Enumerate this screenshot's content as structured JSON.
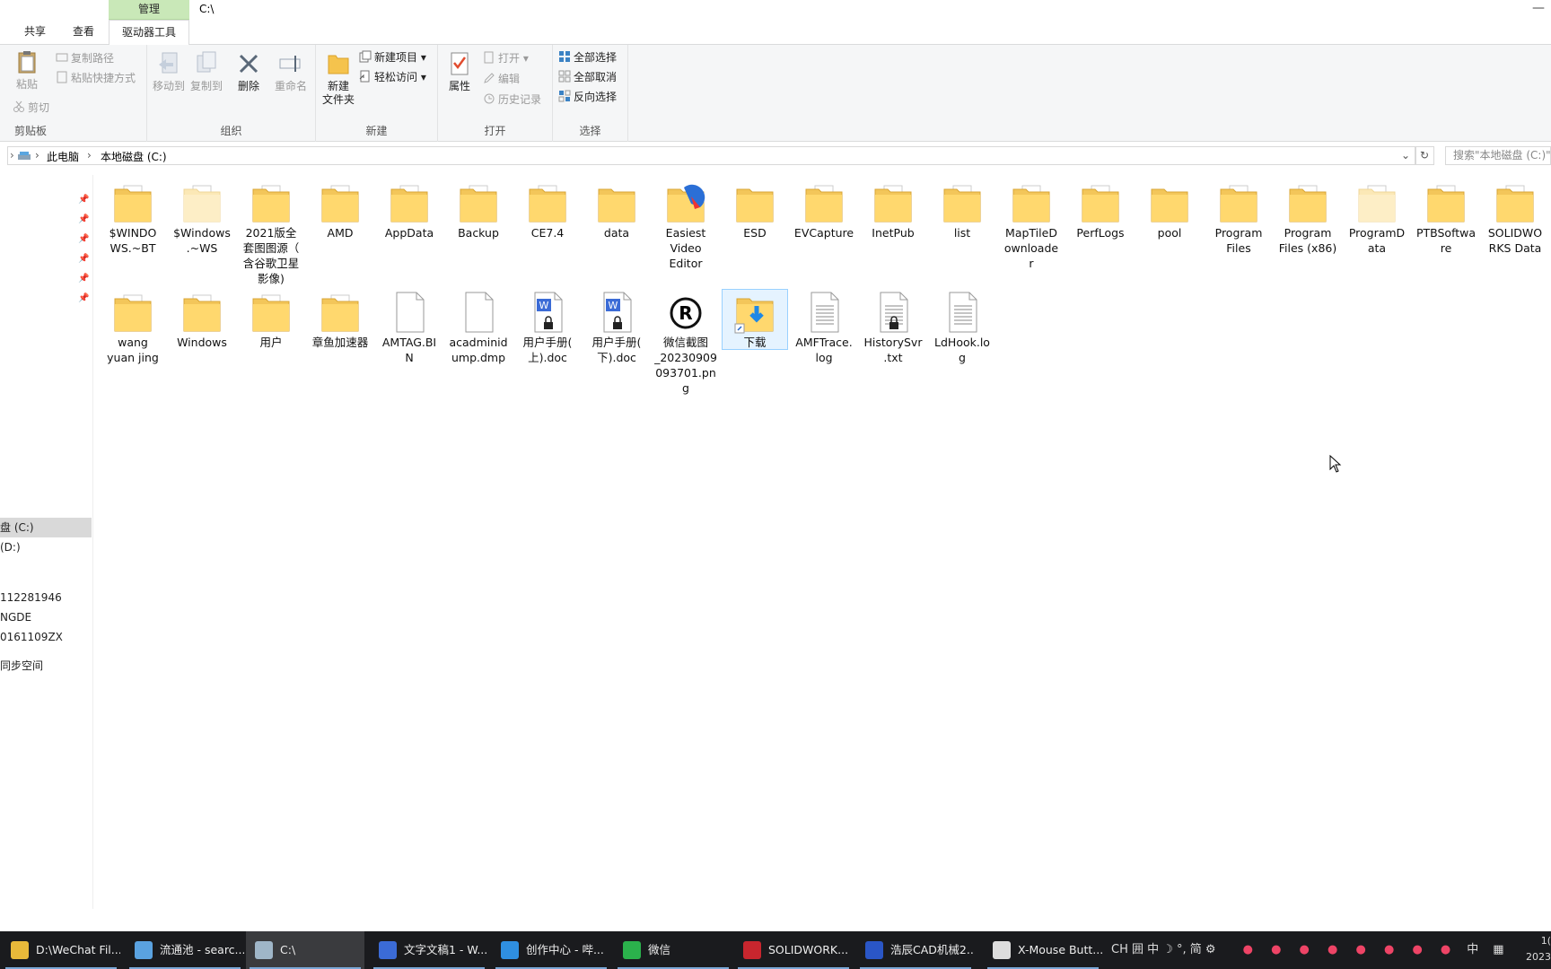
{
  "window": {
    "title": "C:\\",
    "context_group": "管理",
    "minimize": "—"
  },
  "tabs": {
    "share": "共享",
    "view": "查看",
    "drive_tools": "驱动器工具"
  },
  "ribbon": {
    "clipboard": {
      "label": "剪贴板",
      "paste": "粘贴",
      "copy_path": "复制路径",
      "paste_shortcut": "粘贴快捷方式",
      "cut": "剪切"
    },
    "organize": {
      "label": "组织",
      "move_to": "移动到",
      "copy_to": "复制到",
      "delete": "删除",
      "rename": "重命名"
    },
    "new": {
      "label": "新建",
      "new_folder_l1": "新建",
      "new_folder_l2": "文件夹",
      "new_item": "新建项目",
      "easy_access": "轻松访问"
    },
    "open": {
      "label": "打开",
      "properties": "属性",
      "open": "打开",
      "edit": "编辑",
      "history": "历史记录"
    },
    "select": {
      "label": "选择",
      "select_all": "全部选择",
      "select_none": "全部取消",
      "invert": "反向选择"
    }
  },
  "address": {
    "this_pc": "此电脑",
    "drive": "本地磁盘 (C:)",
    "search_placeholder": "搜索\"本地磁盘 (C:)\""
  },
  "nav": {
    "items": [
      "盘 (C:)",
      "(D:)",
      "112281946",
      "NGDE",
      "0161109ZX",
      "同步空间"
    ]
  },
  "files": [
    {
      "l1": "$WINDO",
      "l2": "WS.~BT",
      "l3": "",
      "l4": "",
      "kind": "folder-doc"
    },
    {
      "l1": "$Windows",
      "l2": ".~WS",
      "l3": "",
      "l4": "",
      "kind": "folder-faded"
    },
    {
      "l1": "2021版全",
      "l2": "套图图源（",
      "l3": "含谷歌卫星",
      "l4": "影像)",
      "kind": "folder-doc"
    },
    {
      "l1": "AMD",
      "l2": "",
      "l3": "",
      "l4": "",
      "kind": "folder-doc"
    },
    {
      "l1": "AppData",
      "l2": "",
      "l3": "",
      "l4": "",
      "kind": "folder-doc"
    },
    {
      "l1": "Backup",
      "l2": "",
      "l3": "",
      "l4": "",
      "kind": "folder-doc"
    },
    {
      "l1": "CE7.4",
      "l2": "",
      "l3": "",
      "l4": "",
      "kind": "folder-doc"
    },
    {
      "l1": "data",
      "l2": "",
      "l3": "",
      "l4": "",
      "kind": "folder"
    },
    {
      "l1": "Easiest",
      "l2": "Video",
      "l3": "Editor",
      "l4": "",
      "kind": "folder-app"
    },
    {
      "l1": "ESD",
      "l2": "",
      "l3": "",
      "l4": "",
      "kind": "folder"
    },
    {
      "l1": "EVCapture",
      "l2": "",
      "l3": "",
      "l4": "",
      "kind": "folder-doc"
    },
    {
      "l1": "InetPub",
      "l2": "",
      "l3": "",
      "l4": "",
      "kind": "folder-doc"
    },
    {
      "l1": "list",
      "l2": "",
      "l3": "",
      "l4": "",
      "kind": "folder-doc"
    },
    {
      "l1": "MapTileD",
      "l2": "ownloade",
      "l3": "r",
      "l4": "",
      "kind": "folder-doc"
    },
    {
      "l1": "PerfLogs",
      "l2": "",
      "l3": "",
      "l4": "",
      "kind": "folder-doc"
    },
    {
      "l1": "pool",
      "l2": "",
      "l3": "",
      "l4": "",
      "kind": "folder"
    },
    {
      "l1": "Program",
      "l2": "Files",
      "l3": "",
      "l4": "",
      "kind": "folder-doc"
    },
    {
      "l1": "Program",
      "l2": "Files (x86)",
      "l3": "",
      "l4": "",
      "kind": "folder-doc"
    },
    {
      "l1": "ProgramD",
      "l2": "ata",
      "l3": "",
      "l4": "",
      "kind": "folder-faded"
    },
    {
      "l1": "PTBSoftwa",
      "l2": "re",
      "l3": "",
      "l4": "",
      "kind": "folder-doc"
    },
    {
      "l1": "SOLIDWO",
      "l2": "RKS Data",
      "l3": "",
      "l4": "",
      "kind": "folder-doc"
    },
    {
      "l1": "wang",
      "l2": "yuan jing",
      "l3": "",
      "l4": "",
      "kind": "folder-doc"
    },
    {
      "l1": "Windows",
      "l2": "",
      "l3": "",
      "l4": "",
      "kind": "folder-doc"
    },
    {
      "l1": "用户",
      "l2": "",
      "l3": "",
      "l4": "",
      "kind": "folder-doc"
    },
    {
      "l1": "章鱼加速器",
      "l2": "",
      "l3": "",
      "l4": "",
      "kind": "folder-doc"
    },
    {
      "l1": "AMTAG.BI",
      "l2": "N",
      "l3": "",
      "l4": "",
      "kind": "file"
    },
    {
      "l1": "acadminid",
      "l2": "ump.dmp",
      "l3": "",
      "l4": "",
      "kind": "file"
    },
    {
      "l1": "用户手册(",
      "l2": "上).doc",
      "l3": "",
      "l4": "",
      "kind": "word"
    },
    {
      "l1": "用户手册(",
      "l2": "下).doc",
      "l3": "",
      "l4": "",
      "kind": "word"
    },
    {
      "l1": "微信截图",
      "l2": "_20230909",
      "l3": "093701.pn",
      "l4": "g",
      "kind": "image"
    },
    {
      "l1": "下载",
      "l2": "",
      "l3": "",
      "l4": "",
      "kind": "download"
    },
    {
      "l1": "AMFTrace.",
      "l2": "log",
      "l3": "",
      "l4": "",
      "kind": "text"
    },
    {
      "l1": "HistorySvr",
      "l2": ".txt",
      "l3": "",
      "l4": "",
      "kind": "text-lock"
    },
    {
      "l1": "LdHook.lo",
      "l2": "g",
      "l3": "",
      "l4": "",
      "kind": "text"
    }
  ],
  "taskbar": {
    "items": [
      {
        "label": "D:\\WeChat Fil...",
        "color": "#e8b93a"
      },
      {
        "label": "流通池 - searc...",
        "color": "#5aa2e0"
      },
      {
        "label": "C:\\",
        "color": "#9fb6c8"
      },
      {
        "label": "文字文稿1 - W...",
        "color": "#3b6bd6"
      },
      {
        "label": "创作中心 - 哔...",
        "color": "#2f8fe0"
      },
      {
        "label": "微信",
        "color": "#2bb24c"
      },
      {
        "label": "SOLIDWORK...",
        "color": "#c8262e"
      },
      {
        "label": "浩辰CAD机械2...",
        "color": "#2a56c6"
      },
      {
        "label": "X-Mouse Butt...",
        "color": "#dddddd"
      }
    ],
    "tray_text": "CH 囲 中 ☽ °, 简 ⚙",
    "ime": "中",
    "clock_l1": "1(",
    "clock_l2": "2023"
  }
}
